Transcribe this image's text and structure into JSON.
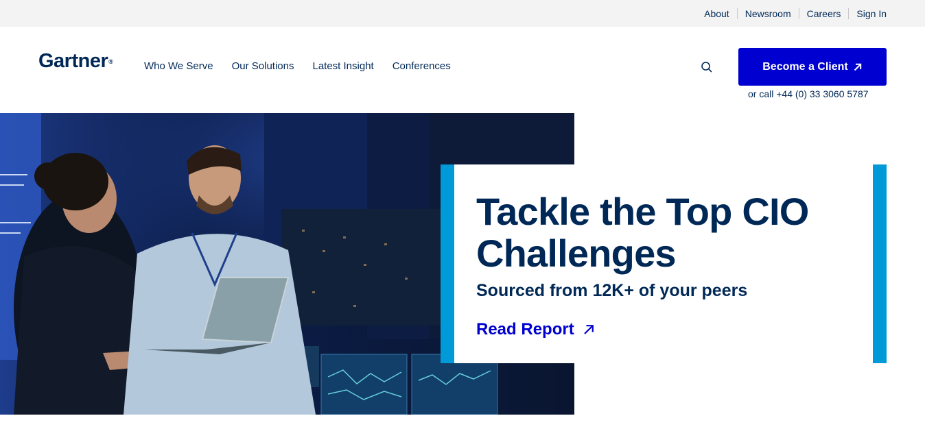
{
  "utility_nav": {
    "links": [
      {
        "label": "About"
      },
      {
        "label": "Newsroom"
      },
      {
        "label": "Careers"
      },
      {
        "label": "Sign In"
      }
    ]
  },
  "header": {
    "logo_text": "Gartner",
    "logo_mark": "®",
    "nav": [
      {
        "label": "Who We Serve"
      },
      {
        "label": "Our Solutions"
      },
      {
        "label": "Latest Insight"
      },
      {
        "label": "Conferences"
      }
    ],
    "search_icon": "search-icon",
    "cta_label": "Become a Client",
    "cta_icon": "arrow-up-right-icon",
    "call_text": "or call +44 (0) 33 3060 5787"
  },
  "hero": {
    "image_description_icon": "hero-photo",
    "title": "Tackle the Top CIO Challenges",
    "subtitle": "Sourced from 12K+ of your peers",
    "link_label": "Read Report",
    "link_icon": "arrow-up-right-icon"
  },
  "colors": {
    "navy": "#002856",
    "cta_blue": "#0000d0",
    "accent_cyan": "#009ad8",
    "utility_bg": "#f3f3f3"
  }
}
